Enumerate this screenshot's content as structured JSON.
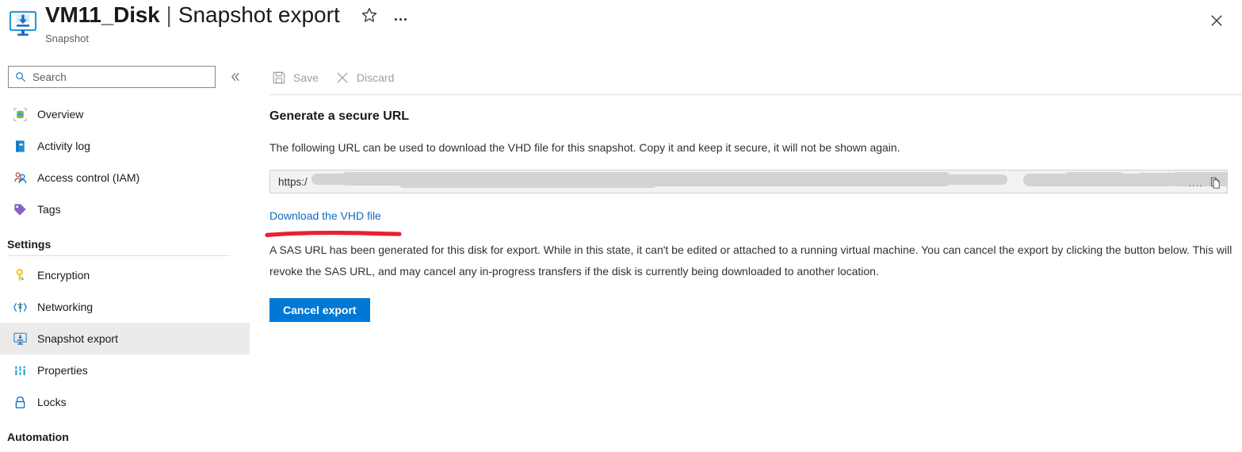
{
  "header": {
    "resource_name": "VM11_Disk",
    "separator": "|",
    "page_name": "Snapshot export",
    "subtitle": "Snapshot",
    "favorite_icon": "star-icon",
    "more_icon": "ellipsis-icon",
    "close_icon": "close-icon",
    "blade_icon": "snapshot-export-icon"
  },
  "sidebar": {
    "search": {
      "placeholder": "Search",
      "value": "",
      "icon": "search-icon"
    },
    "collapse_icon": "chevron-double-left-icon",
    "items": [
      {
        "label": "Overview",
        "icon": "overview-icon",
        "selected": false
      },
      {
        "label": "Activity log",
        "icon": "activity-log-icon",
        "selected": false
      },
      {
        "label": "Access control (IAM)",
        "icon": "access-control-icon",
        "selected": false
      },
      {
        "label": "Tags",
        "icon": "tag-icon",
        "selected": false
      }
    ],
    "groups": [
      {
        "title": "Settings",
        "items": [
          {
            "label": "Encryption",
            "icon": "key-icon",
            "selected": false
          },
          {
            "label": "Networking",
            "icon": "networking-icon",
            "selected": false
          },
          {
            "label": "Snapshot export",
            "icon": "snapshot-export-icon",
            "selected": true
          },
          {
            "label": "Properties",
            "icon": "properties-icon",
            "selected": false
          },
          {
            "label": "Locks",
            "icon": "lock-icon",
            "selected": false
          }
        ]
      },
      {
        "title": "Automation",
        "items": []
      }
    ]
  },
  "toolbar": {
    "save_label": "Save",
    "save_icon": "save-disk-icon",
    "discard_label": "Discard",
    "discard_icon": "discard-x-icon",
    "disabled": true
  },
  "main": {
    "section_title": "Generate a secure URL",
    "section_desc": "The following URL can be used to download the VHD file for this snapshot. Copy it and keep it secure, it will not be shown again.",
    "url_field": {
      "visible_text": "https:/",
      "redacted": true,
      "trailing_ellipsis": "....",
      "copy_icon": "copy-icon"
    },
    "download_link": "Download the VHD file",
    "annotation": {
      "type": "red-underline",
      "color": "#e8222b"
    },
    "sas_paragraph": "A SAS URL has been generated for this disk for export. While in this state, it can't be edited or attached to a running virtual machine. You can cancel the export by clicking the button below. This will revoke the SAS URL, and may cancel any in-progress transfers if the disk is currently being downloaded to another location.",
    "cancel_button": "Cancel export"
  },
  "colors": {
    "accent": "#0078d4",
    "link": "#0f6cbd",
    "selected_row": "#edebe9",
    "annotation_red": "#e8222b",
    "field_bg": "#f3f2f1"
  }
}
